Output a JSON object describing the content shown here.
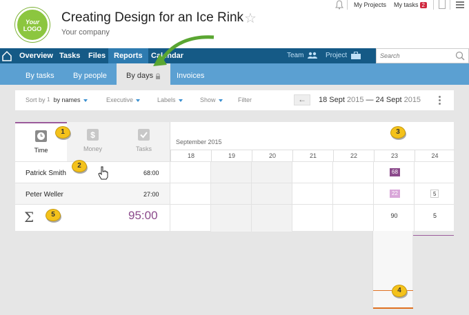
{
  "header": {
    "logo_line1": "Your",
    "logo_line2": "LOGO",
    "title": "Creating Design for an Ice Rink",
    "star_icon": "☆",
    "company": "Your company",
    "my_projects": "My Projects",
    "my_tasks": "My tasks",
    "my_tasks_count": "2"
  },
  "nav": {
    "items": [
      "Overview",
      "Tasks",
      "Files",
      "Reports",
      "Calendar"
    ],
    "active": "Reports",
    "team": "Team",
    "project": "Project",
    "search_placeholder": "Search"
  },
  "subnav": {
    "items": [
      "By tasks",
      "By people",
      "By days",
      "Invoices"
    ],
    "active": "By days"
  },
  "filters": {
    "sort_label": "Sort by",
    "sort_num": "1",
    "sort_value": "by names",
    "executive": "Executive",
    "labels": "Labels",
    "show": "Show",
    "filter": "Filter",
    "date_from_day": "18 Sept",
    "date_from_year": "2015",
    "date_sep": "—",
    "date_to_day": "24 Sept",
    "date_to_year": "2015"
  },
  "modes": [
    "Time",
    "Money",
    "Tasks"
  ],
  "calendar": {
    "month": "September 2015",
    "days": [
      "18",
      "19",
      "20",
      "21",
      "22",
      "23",
      "24"
    ]
  },
  "rows": [
    {
      "name": "Patrick Smith",
      "hours": "68:00",
      "day23": "68",
      "day24": ""
    },
    {
      "name": "Peter Weller",
      "hours": "27:00",
      "day23": "22",
      "day24": "5"
    }
  ],
  "totals": {
    "sigma": "Σ",
    "total": "95:00",
    "day23": "90",
    "day24": "5"
  },
  "callouts": [
    "1",
    "2",
    "3",
    "4",
    "5"
  ],
  "colors": {
    "nav": "#155a86",
    "subnav": "#5ba0d2",
    "accent": "#8b4a8b",
    "badge": "#d0283e",
    "callout": "#f4c21b"
  }
}
